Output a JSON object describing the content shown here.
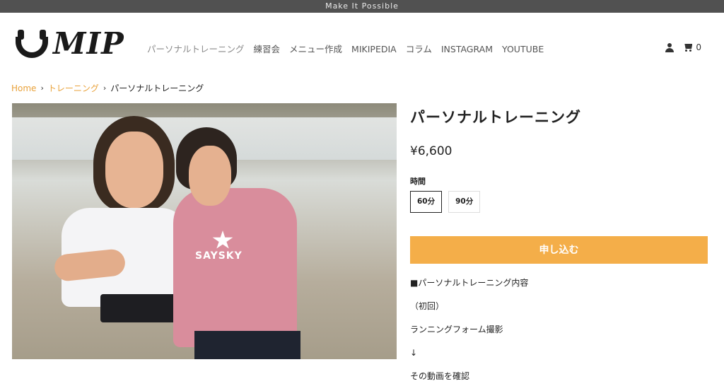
{
  "announcement": "Make It Possible",
  "logo": {
    "word": "MIP"
  },
  "nav": {
    "items": [
      "パーソナルトレーニング",
      "練習会",
      "メニュー作成",
      "MIKIPEDIA",
      "コラム",
      "INSTAGRAM",
      "YOUTUBE"
    ]
  },
  "header_icons": {
    "account": "user-icon",
    "cart": "cart-icon",
    "cart_count": "0"
  },
  "breadcrumb": {
    "home": "Home",
    "category": "トレーニング",
    "current": "パーソナルトレーニング",
    "separator": "›"
  },
  "product": {
    "title": "パーソナルトレーニング",
    "price": "¥6,600",
    "option_label": "時間",
    "options": [
      {
        "label": "60分",
        "selected": true
      },
      {
        "label": "90分",
        "selected": false
      }
    ],
    "apply_button": "申し込む",
    "apply_color": "#f4ae49",
    "description": [
      "■パーソナルトレーニング内容",
      "（初回）",
      "ランニングフォーム撮影",
      "↓",
      "その動画を確認"
    ]
  },
  "photo": {
    "shirt_text": "SAYSKY"
  },
  "colors": {
    "accent": "#e9a23b",
    "announce_bar": "#515151"
  }
}
